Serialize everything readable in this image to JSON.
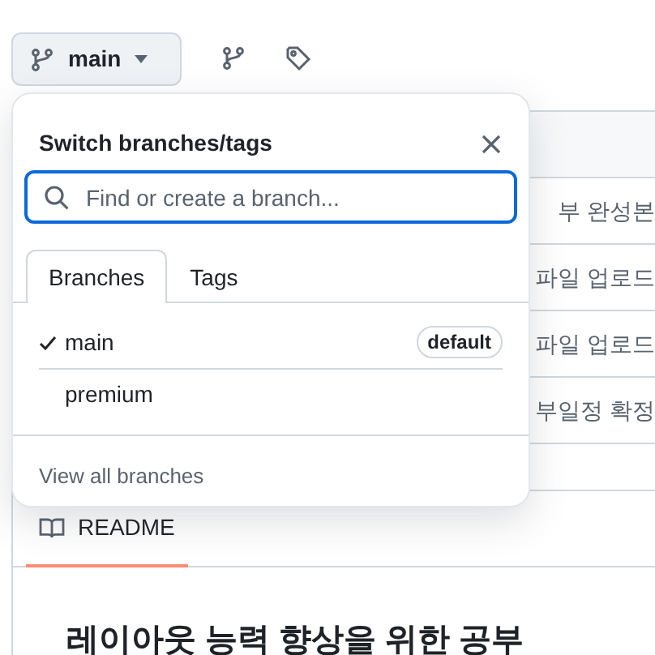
{
  "toolbar": {
    "branch_button": {
      "label": "main"
    }
  },
  "file_rows": [
    {
      "message": "부 완성본"
    },
    {
      "message": "파일 업로드"
    },
    {
      "message": "파일 업로드"
    },
    {
      "message": "부일정 확정"
    }
  ],
  "readme": {
    "tab": "README",
    "heading": "레이아웃 능력 향상을 위한 공부"
  },
  "popover": {
    "title": "Switch branches/tags",
    "search": {
      "placeholder": "Find or create a branch..."
    },
    "tabs": [
      {
        "label": "Branches",
        "selected": true
      },
      {
        "label": "Tags",
        "selected": false
      }
    ],
    "branches": [
      {
        "name": "main",
        "selected": true,
        "badge": "default"
      },
      {
        "name": "premium",
        "selected": false
      }
    ],
    "footer_link": "View all branches"
  }
}
